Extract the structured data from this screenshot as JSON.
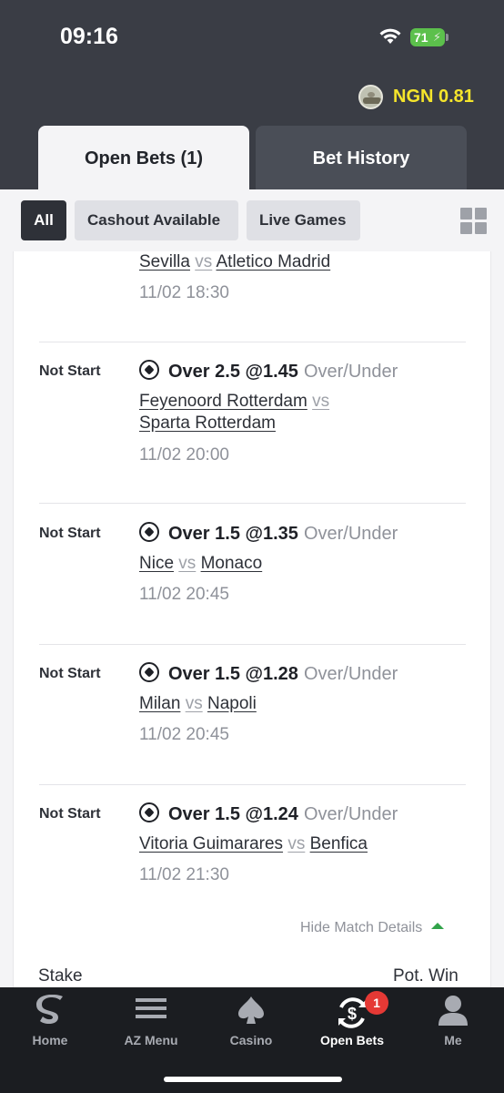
{
  "status_bar": {
    "time": "09:16",
    "battery": "71"
  },
  "header": {
    "balance": "NGN 0.81"
  },
  "tabs": [
    {
      "label": "Open Bets (1)",
      "active": true
    },
    {
      "label": "Bet History",
      "active": false
    }
  ],
  "filters": [
    {
      "label": "All",
      "active": true
    },
    {
      "label": "Cashout Available",
      "active": false
    },
    {
      "label": "Live Games",
      "active": false
    }
  ],
  "partial_selection": {
    "home": "Sevilla",
    "vs": "vs",
    "away": "Atletico Madrid",
    "date": "11/02 18:30"
  },
  "selections": [
    {
      "status": "Not Start",
      "pick": "Over 2.5 @1.45",
      "market": "Over/Under",
      "home": "Feyenoord Rotterdam",
      "vs": "vs",
      "away": "Sparta Rotterdam",
      "date": "11/02 20:00"
    },
    {
      "status": "Not Start",
      "pick": "Over 1.5 @1.35",
      "market": "Over/Under",
      "home": "Nice",
      "vs": "vs",
      "away": "Monaco",
      "date": "11/02 20:45"
    },
    {
      "status": "Not Start",
      "pick": "Over 1.5 @1.28",
      "market": "Over/Under",
      "home": "Milan",
      "vs": "vs",
      "away": "Napoli",
      "date": "11/02 20:45"
    },
    {
      "status": "Not Start",
      "pick": "Over 1.5 @1.24",
      "market": "Over/Under",
      "home": "Vitoria Guimarares",
      "vs": "vs",
      "away": "Benfica",
      "date": "11/02 21:30"
    }
  ],
  "details": {
    "hide_label": "Hide Match Details",
    "stake_label": "Stake",
    "pot_win_label": "Pot. Win"
  },
  "bottom_nav": [
    {
      "label": "Home",
      "icon": "sporty-logo-icon"
    },
    {
      "label": "AZ Menu",
      "icon": "menu-icon"
    },
    {
      "label": "Casino",
      "icon": "spade-icon"
    },
    {
      "label": "Open Bets",
      "icon": "open-bets-icon",
      "active": true,
      "badge": "1"
    },
    {
      "label": "Me",
      "icon": "user-icon"
    }
  ],
  "colors": {
    "header_bg": "#3a3d45",
    "balance": "#f5e52b",
    "battery": "#5cc04c",
    "badge": "#e53935",
    "nav_bg": "#1b1d21"
  }
}
